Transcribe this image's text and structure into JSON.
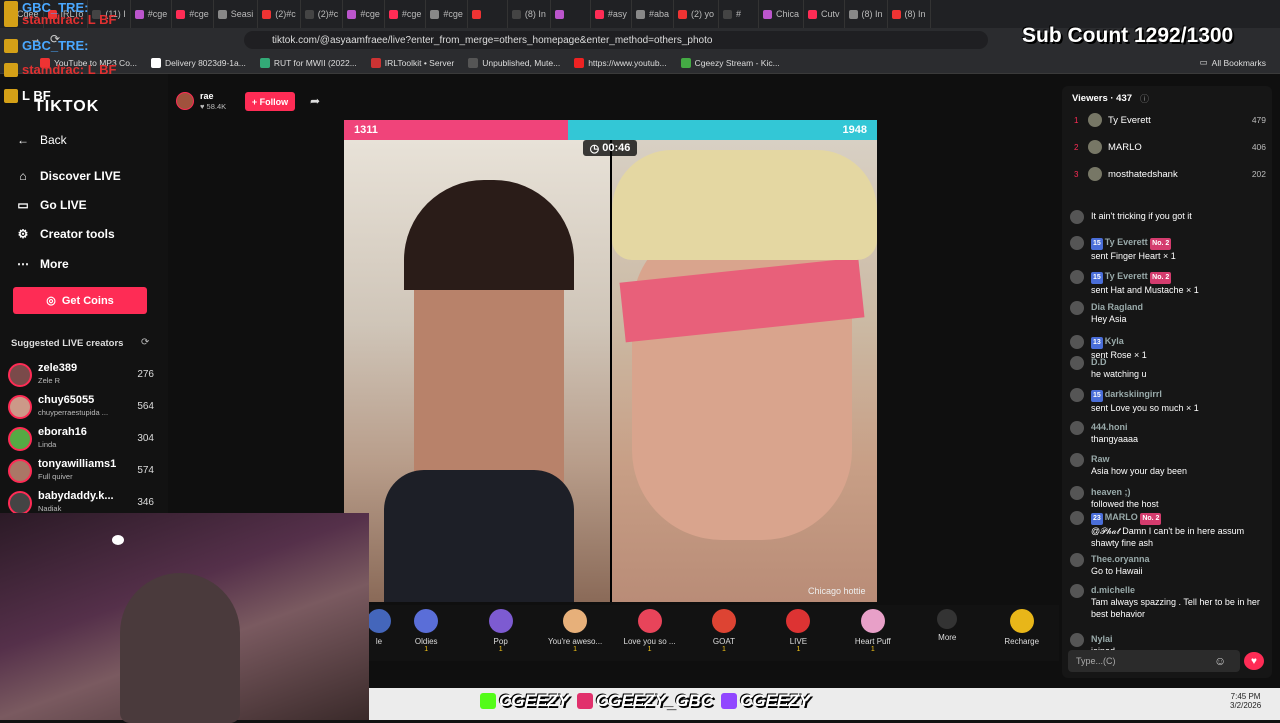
{
  "browser": {
    "tabs": [
      "Cgee",
      "IRLTo",
      "(11) I",
      "#cge",
      "#cge",
      "Seasi",
      "(2)#c",
      "(2)#c",
      "#cge",
      "#cge",
      "#cge",
      "",
      "(8) In",
      "",
      "#asy",
      "#aba",
      "(2) yo",
      "#",
      "Chica",
      "Cutv",
      "(8) In",
      "(8) In"
    ],
    "url": "tiktok.com/@asyaamfraee/live?enter_from_merge=others_homepage&enter_method=others_photo",
    "bookmarks": [
      "YouTube to MP3 Co...",
      "Delivery 8023d9-1a...",
      "RUT for MWII (2022...",
      "IRLToolkit • Server",
      "Unpublished, Mute...",
      "https://www.youtub...",
      "Cgeezy Stream - Kic..."
    ],
    "all_bookmarks": "All Bookmarks"
  },
  "overlay": {
    "lines": [
      "GBC_TRE:",
      "stamdrac: L BF",
      "GBC_TRE:",
      "stamdrac: L BF",
      "L BF"
    ],
    "sub_count": "Sub Count 1292/1300"
  },
  "sidebar": {
    "logo": "TIKTOK",
    "back": "Back",
    "nav": [
      "Discover LIVE",
      "Go LIVE",
      "Creator tools",
      "More"
    ],
    "get_coins": "Get Coins",
    "suggested_title": "Suggested LIVE creators",
    "creators": [
      {
        "name": "zele389",
        "sub": "Zele R",
        "count": "276"
      },
      {
        "name": "chuy65055",
        "sub": "chuyperraestupida ...",
        "count": "564"
      },
      {
        "name": "eborah16",
        "sub": "Linda",
        "count": "304"
      },
      {
        "name": "tonyawilliams1",
        "sub": "Full quiver",
        "count": "574"
      },
      {
        "name": "babydaddy.k...",
        "sub": "Nadiak",
        "count": "346"
      }
    ]
  },
  "host": {
    "name": "rae",
    "likes": "58.4K",
    "follow": "+ Follow"
  },
  "battle": {
    "left_score": "1311",
    "right_score": "1948",
    "timer": "00:46",
    "caption": "Chicago hottie"
  },
  "gifts": [
    {
      "name": "le",
      "cost": ""
    },
    {
      "name": "Oldies",
      "cost": "1"
    },
    {
      "name": "Pop",
      "cost": "1"
    },
    {
      "name": "You're aweso...",
      "cost": "1"
    },
    {
      "name": "Love you so ...",
      "cost": "1"
    },
    {
      "name": "GOAT",
      "cost": "1"
    },
    {
      "name": "LIVE",
      "cost": "1"
    },
    {
      "name": "Heart Puff",
      "cost": "1"
    },
    {
      "name": "More",
      "cost": ""
    },
    {
      "name": "Recharge",
      "cost": ""
    }
  ],
  "viewers": {
    "title": "Viewers · 437",
    "top": [
      {
        "rank": "1",
        "name": "Ty Everett",
        "score": "479"
      },
      {
        "rank": "2",
        "name": "MARLO",
        "score": "406"
      },
      {
        "rank": "3",
        "name": "mosthatedshank",
        "score": "202"
      }
    ]
  },
  "chat": [
    {
      "user": "",
      "text": "It ain't tricking if you got it"
    },
    {
      "user": "Ty Everett",
      "lvl": "15",
      "badge": "No. 2",
      "text": "sent Finger Heart × 1"
    },
    {
      "user": "Ty Everett",
      "lvl": "15",
      "badge": "No. 2",
      "text": "sent Hat and Mustache × 1"
    },
    {
      "user": "Dia Ragland",
      "text": "Hey Asia"
    },
    {
      "user": "Kyla",
      "lvl": "13",
      "text": "sent Rose × 1"
    },
    {
      "user": "D.D",
      "text": "he watching u"
    },
    {
      "user": "darkskiingirrl",
      "lvl": "15",
      "text": "sent Love you so much × 1"
    },
    {
      "user": "444.honi",
      "text": "thangyaaaa"
    },
    {
      "user": "Raw",
      "text": "Asia how your day been"
    },
    {
      "user": "heaven ;)",
      "text": "followed the host"
    },
    {
      "user": "MARLO",
      "lvl": "23",
      "badge": "No. 2",
      "text": "@𝒫𝒽𝒶𝓉 Damn I can't be in here assum shawty fine ash"
    },
    {
      "user": "Thee.oryanna",
      "text": "Go to Hawaii"
    },
    {
      "user": "d.michelle",
      "text": "Tam always spazzing . Tell her to be in her best behavior"
    },
    {
      "user": "Nylai",
      "text": "joined"
    }
  ],
  "chat_placeholder": "Type...(C)",
  "stream_socials": [
    "CGEEZY",
    "CGEEZY_GBC",
    "CGEEZY"
  ],
  "tray": {
    "time": "7:45 PM",
    "date": "3/2/2026"
  }
}
